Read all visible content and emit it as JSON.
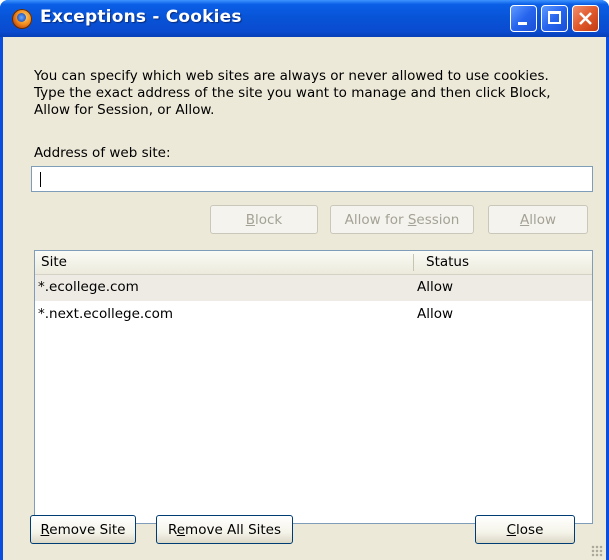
{
  "window": {
    "title": "Exceptions - Cookies",
    "icon": "firefox-icon",
    "controls": {
      "minimize": "minimize-icon",
      "maximize": "maximize-icon",
      "close": "close-icon"
    }
  },
  "description_lines": [
    "You can specify which web sites are always or never allowed to use cookies.",
    "Type the exact address of the site you want to manage and then click Block,",
    "Allow for Session, or Allow."
  ],
  "address": {
    "label": "Address of web site:",
    "value": "",
    "placeholder": ""
  },
  "action_buttons": {
    "block": {
      "pre": "",
      "ul": "B",
      "post": "lock"
    },
    "allow_session": {
      "pre": "Allow for ",
      "ul": "S",
      "post": "ession"
    },
    "allow": {
      "pre": "",
      "ul": "A",
      "post": "llow"
    }
  },
  "table": {
    "columns": {
      "site": "Site",
      "status": "Status"
    },
    "rows": [
      {
        "site": "*.ecollege.com",
        "status": "Allow",
        "selected": true
      },
      {
        "site": "*.next.ecollege.com",
        "status": "Allow",
        "selected": false
      }
    ]
  },
  "footer_buttons": {
    "remove_site": {
      "pre": "",
      "ul": "R",
      "post": "emove Site"
    },
    "remove_all": {
      "pre": "R",
      "ul": "e",
      "post": "move All Sites"
    },
    "close": {
      "pre": "",
      "ul": "C",
      "post": "lose"
    }
  },
  "colors": {
    "titlebar": "#0a4ee0",
    "dialog_bg": "#ece9d8",
    "selected_row": "#eeebe4"
  }
}
